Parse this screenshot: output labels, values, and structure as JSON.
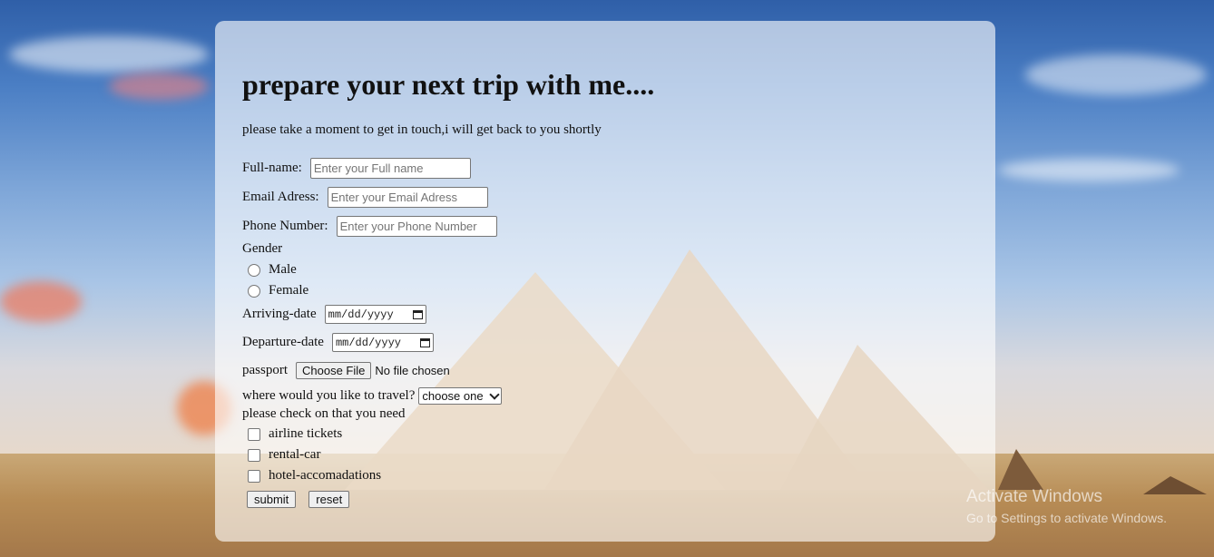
{
  "heading": "prepare your next trip with me....",
  "intro": "please take a moment to get in touch,i will get back to you shortly",
  "fields": {
    "fullname": {
      "label": "Full-name:",
      "placeholder": "Enter your Full name"
    },
    "email": {
      "label": "Email Adress:",
      "placeholder": "Enter your Email Adress"
    },
    "phone": {
      "label": "Phone Number:",
      "placeholder": "Enter your Phone Number"
    }
  },
  "gender": {
    "label": "Gender",
    "options": [
      "Male",
      "Female"
    ]
  },
  "arriving": {
    "label": "Arriving-date",
    "value": "mm/dd/yyyy"
  },
  "departure": {
    "label": "Departure-date",
    "value": "mm/dd/yyyy"
  },
  "passport": {
    "label": "passport",
    "button": "Choose File",
    "status": "No file chosen"
  },
  "travel": {
    "label": "where would you like to travel?",
    "selected": "choose one"
  },
  "needs": {
    "label": "please check on that you need",
    "options": [
      "airline tickets",
      "rental-car",
      "hotel-accomadations"
    ]
  },
  "buttons": {
    "submit": "submit",
    "reset": "reset"
  },
  "watermark": {
    "title": "Activate Windows",
    "subtitle": "Go to Settings to activate Windows."
  }
}
